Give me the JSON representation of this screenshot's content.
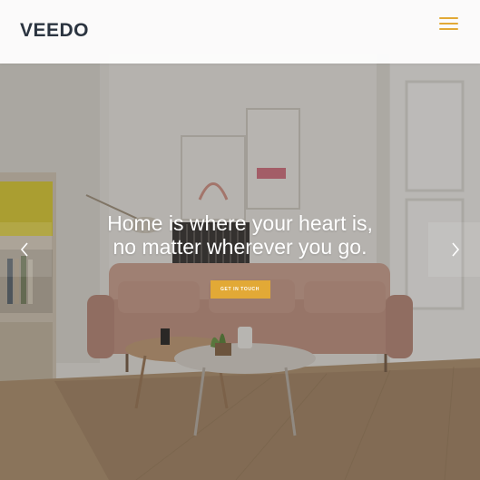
{
  "header": {
    "logo_text": "VEEDO",
    "menu_icon": "hamburger-menu-icon"
  },
  "hero": {
    "headline_line1": "Home is where your heart is,",
    "headline_line2": "no matter wherever you go.",
    "cta_label": "GET IN TOUCH",
    "prev_icon": "chevron-left-icon",
    "next_icon": "chevron-right-icon"
  },
  "colors": {
    "accent": "#e2a936",
    "logo": "#2b3440",
    "sofa": "#c79a8a",
    "floor": "#a98c6d"
  }
}
